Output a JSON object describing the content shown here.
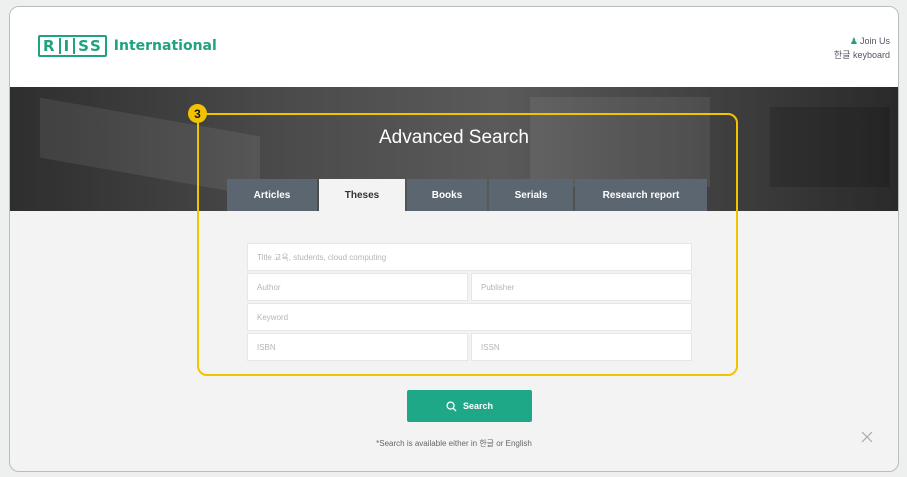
{
  "brand": {
    "logo_letters": [
      "R",
      "I",
      "S",
      "S"
    ],
    "name": "International",
    "color": "#1fa27f"
  },
  "header_links": {
    "join": "Join Us",
    "keyboard": "한글 keyboard"
  },
  "hero": {
    "title": "Advanced Search"
  },
  "tabs": [
    {
      "label": "Articles",
      "active": false
    },
    {
      "label": "Theses",
      "active": true
    },
    {
      "label": "Books",
      "active": false
    },
    {
      "label": "Serials",
      "active": false
    },
    {
      "label": "Research report",
      "active": false
    }
  ],
  "form": {
    "title": "Title 교육, students, cloud computing",
    "author": "Author",
    "publisher": "Publisher",
    "keyword": "Keyword",
    "isbn": "ISBN",
    "issn": "ISSN"
  },
  "callout": {
    "number": "3",
    "color": "#f2c400"
  },
  "search": {
    "label": "Search",
    "color": "#1fa888"
  },
  "note": "*Search is available either in 한글 or English",
  "icons": [
    "person-icon",
    "search-icon",
    "close-icon"
  ]
}
